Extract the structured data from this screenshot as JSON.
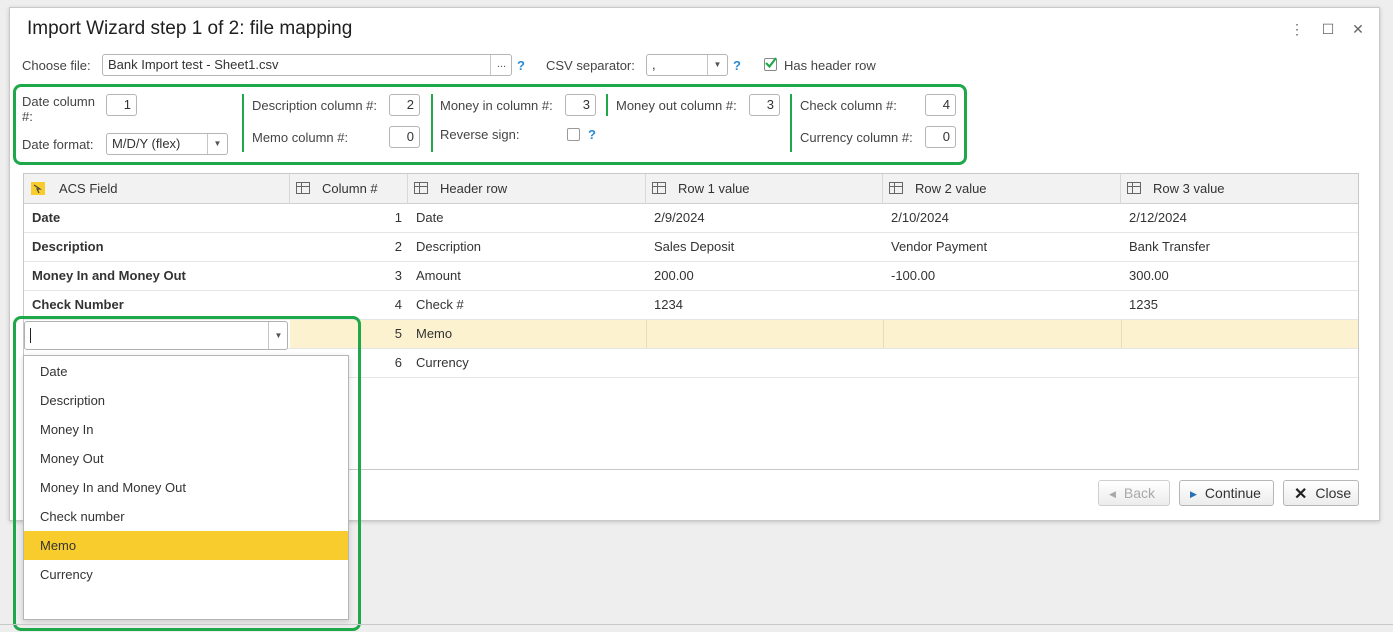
{
  "window": {
    "title": "Import Wizard step 1 of 2: file mapping",
    "more_glyph": "⋮",
    "maximize_glyph": "☐",
    "close_glyph": "✕"
  },
  "file": {
    "choose_label": "Choose file:",
    "value": "Bank Import test - Sheet1.csv",
    "browse_label": "...",
    "help": "?",
    "csv_label": "CSV separator:",
    "csv_value": ",",
    "csv_help": "?",
    "has_header_label": "Has header row",
    "has_header_checked": true
  },
  "mapping": {
    "date_col_label_line1": "Date column",
    "date_col_label_line2": "#:",
    "date_col": "1",
    "date_format_label": "Date format:",
    "date_format": "M/D/Y (flex)",
    "desc_col_label": "Description column #:",
    "desc_col": "2",
    "memo_col_label": "Memo column #:",
    "memo_col": "0",
    "money_in_label": "Money in column #:",
    "money_in": "3",
    "reverse_label": "Reverse sign:",
    "reverse_help": "?",
    "money_out_label": "Money out column #:",
    "money_out": "3",
    "check_col_label": "Check column #:",
    "check_col": "4",
    "currency_col_label": "Currency column #:",
    "currency_col": "0",
    "highlight_color": "#1ea84a"
  },
  "grid": {
    "headers": [
      "ACS Field",
      "Column #",
      "Header row",
      "Row 1 value",
      "Row 2 value",
      "Row 3 value"
    ],
    "rows": [
      {
        "field": "Date",
        "col": "1",
        "header": "Date",
        "r1": "2/9/2024",
        "r2": "2/10/2024",
        "r3": "2/12/2024"
      },
      {
        "field": "Description",
        "col": "2",
        "header": "Description",
        "r1": "Sales Deposit",
        "r2": "Vendor Payment",
        "r3": "Bank Transfer"
      },
      {
        "field": "Money In and Money Out",
        "col": "3",
        "header": "Amount",
        "r1": "200.00",
        "r2": "-100.00",
        "r3": "300.00"
      },
      {
        "field": "Check Number",
        "col": "4",
        "header": "Check #",
        "r1": "1234",
        "r2": "",
        "r3": "1235"
      },
      {
        "field": "",
        "col": "5",
        "header": "Memo",
        "r1": "",
        "r2": "",
        "r3": ""
      },
      {
        "field": "",
        "col": "6",
        "header": "Currency",
        "r1": "",
        "r2": "",
        "r3": ""
      }
    ],
    "selected_row_color": "#fdf2cf"
  },
  "dropdown": {
    "options": [
      "Date",
      "Description",
      "Money In",
      "Money Out",
      "Money In and Money Out",
      "Check number",
      "Memo",
      "Currency"
    ],
    "highlighted": "Memo",
    "highlight_color": "#f9cc2d"
  },
  "buttons": {
    "back": "Back",
    "continue": "Continue",
    "close": "Close"
  }
}
